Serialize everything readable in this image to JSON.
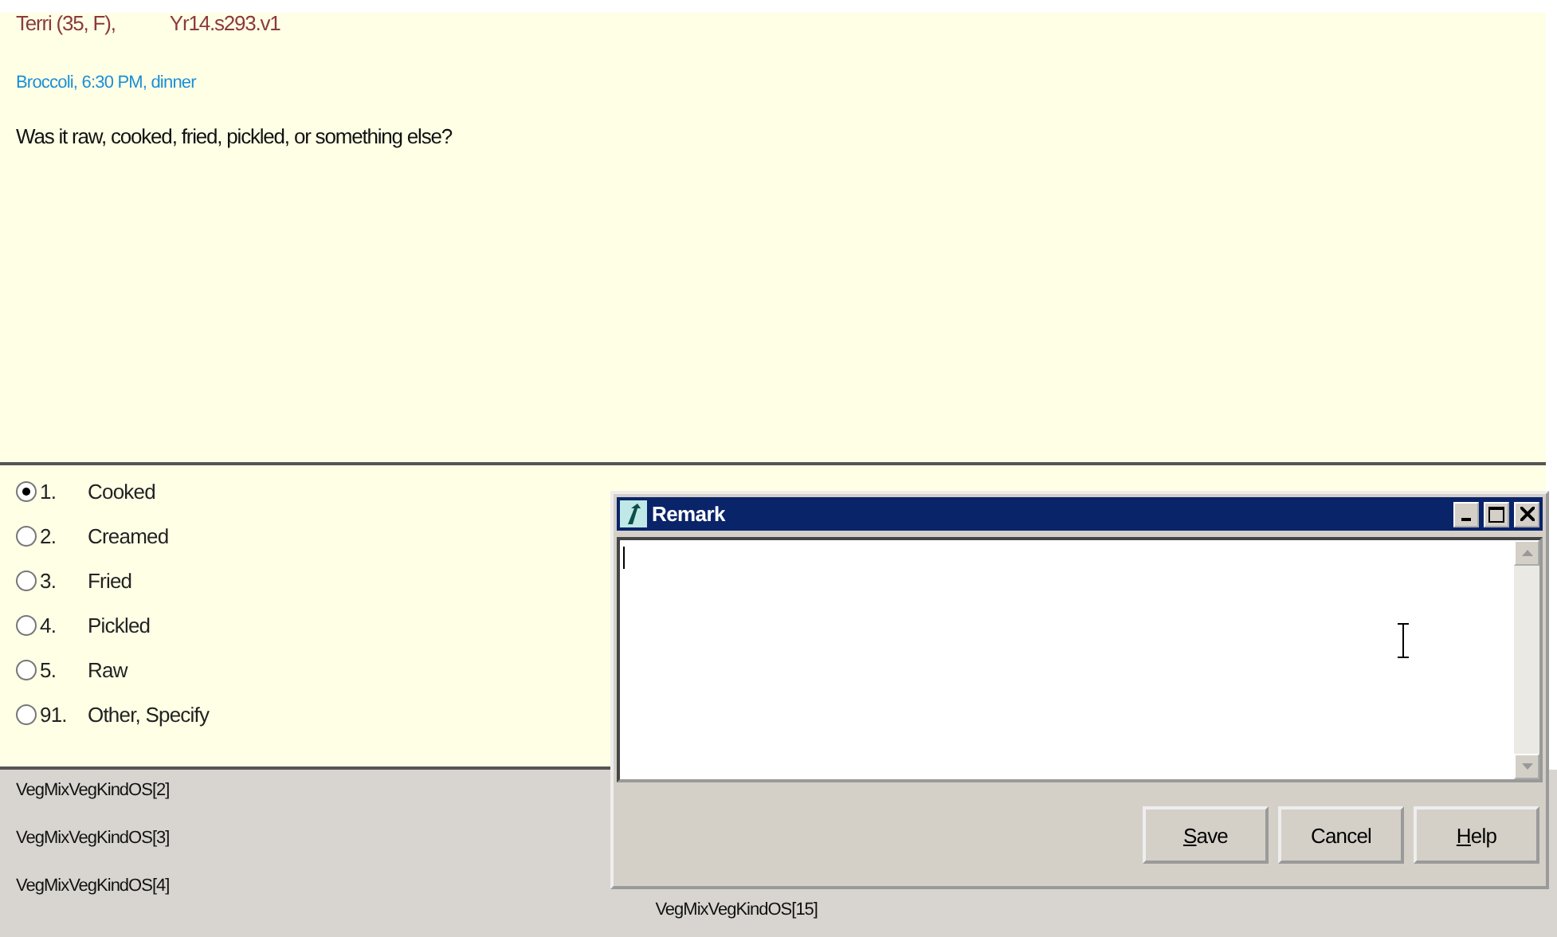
{
  "header": {
    "respondent": "Terri (35, F),",
    "instrument": "Yr14.s293.v1",
    "food_context": "Broccoli, 6:30 PM, dinner",
    "question": "Was it raw, cooked, fried, pickled, or something else?"
  },
  "answers": [
    {
      "code": "1.",
      "label": "Cooked",
      "selected": true
    },
    {
      "code": "2.",
      "label": "Creamed",
      "selected": false
    },
    {
      "code": "3.",
      "label": "Fried",
      "selected": false
    },
    {
      "code": "4.",
      "label": "Pickled",
      "selected": false
    },
    {
      "code": "5.",
      "label": "Raw",
      "selected": false
    },
    {
      "code": "91.",
      "label": "Other, Specify",
      "selected": false
    }
  ],
  "field_list": {
    "column_1": [
      "VegMixVegKindOS[2]",
      "VegMixVegKindOS[3]",
      "VegMixVegKindOS[4]"
    ],
    "column_2": [
      "VegMixVegKindOS[15]"
    ]
  },
  "remark_dialog": {
    "title": "Remark",
    "buttons": [
      {
        "accel": "S",
        "rest": "ave"
      },
      {
        "rest": "Cancel"
      },
      {
        "accel": "H",
        "rest": "elp"
      }
    ]
  }
}
